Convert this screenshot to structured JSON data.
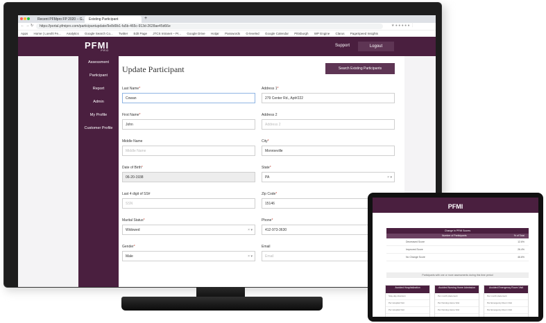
{
  "browser": {
    "tabs": [
      "Recent PFMpro FP 2020 – G...",
      "Existing Participant"
    ],
    "url": "https://portal.pfmipro.com/participantupdate/9e8d9b1-fa5b-465c-913d-2628ae45d66e",
    "bookmarks": [
      "Apps",
      "Home | Loexhl Fe...",
      "Analytics",
      "Google Search Co...",
      "Twitter",
      "Edit Page",
      "JTCS Intranet – Pr...",
      "Google Drive",
      "Hotjar",
      "Passwords",
      "G-leveled",
      "Google Calendar",
      "Pittsburgh",
      "WP Engine",
      "Clarus",
      "PageSpeed Insights"
    ]
  },
  "app": {
    "logo": "PFMI",
    "logo_sub": "PRO",
    "header_links": {
      "support": "Support",
      "logout": "Logout"
    },
    "sidebar": [
      "Assessment",
      "Participant",
      "Report",
      "Admin",
      "My Profile",
      "Customer Profile"
    ],
    "page_title": "Update Participant",
    "search_button": "Search Existing Participants",
    "fields": {
      "last_name": {
        "label": "Last Name",
        "value": "Cowan"
      },
      "first_name": {
        "label": "First Name",
        "value": "John"
      },
      "middle_name": {
        "label": "Middle Name",
        "placeholder": "Middle Name"
      },
      "dob": {
        "label": "Date of Birth",
        "value": "06-20-1938"
      },
      "ssn": {
        "label": "Last 4 digit of SS#",
        "placeholder": "SSN"
      },
      "marital": {
        "label": "Marital Status",
        "value": "Widowed"
      },
      "gender": {
        "label": "Gender",
        "value": "Male"
      },
      "address1": {
        "label": "Address 1",
        "value": "279 Center Rd., Apt#222"
      },
      "address2": {
        "label": "Address 2",
        "placeholder": "Address 2"
      },
      "city": {
        "label": "City",
        "value": "Monroeville"
      },
      "state": {
        "label": "State",
        "value": "PA"
      },
      "zip": {
        "label": "Zip Code",
        "value": "15146"
      },
      "phone": {
        "label": "Phone",
        "value": "412-973-3630"
      },
      "email": {
        "label": "Email",
        "placeholder": "Email"
      }
    }
  },
  "tablet": {
    "logo": "PFMI",
    "table_title": "Change in PFMI Scores",
    "table_cols": [
      "Number of Participants",
      "% of Total"
    ],
    "rows": [
      {
        "label": "Decreased Score",
        "pct": "12.6%"
      },
      {
        "label": "Improved Score",
        "pct": "26.4%"
      },
      {
        "label": "No Change Score",
        "pct": "46.6%"
      }
    ],
    "note": "Participants with one or more assessments during this time period",
    "cards": [
      {
        "title": "Avoided Hospitalization",
        "rows": [
          "Stay-day diversion",
          "Per Hospital Visit",
          "Per Hospital Visit"
        ]
      },
      {
        "title": "Avoided Nursing Home Admission",
        "rows": [
          "Per month placement",
          "Per Nursing Home Visit",
          "Per Nursing Home Visit"
        ]
      },
      {
        "title": "Avoided Emergency Room Visit",
        "rows": [
          "Per month placement",
          "Per Emergency Room Visit",
          "Per Emergency Room Visit"
        ]
      }
    ]
  }
}
